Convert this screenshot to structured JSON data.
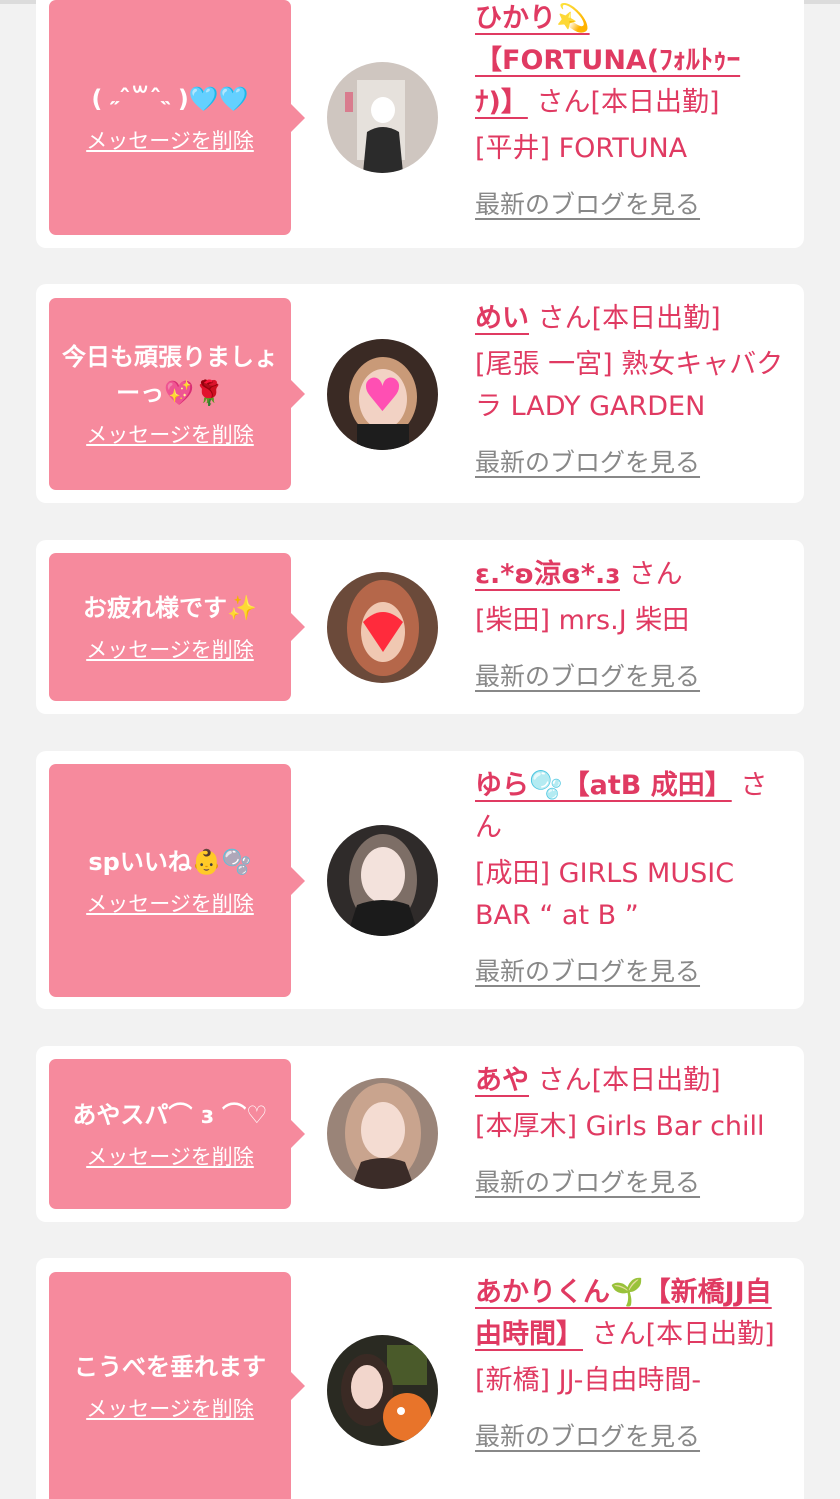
{
  "delete_label": "メッセージを削除",
  "blog_label": "最新のブログを見る",
  "san_label": "さん",
  "cards": [
    {
      "message": "( ˶ˆ꒳ˆ˵ )🩵🩵",
      "name": "ひかり💫【FORTUNA(ﾌｫﾙﾄｩｰﾅ)】",
      "status": "[本日出勤]",
      "shop": "[平井] FORTUNA"
    },
    {
      "message": "今日も頑張りましょーっ💖🌹",
      "name": "めい",
      "status": "[本日出勤]",
      "shop": "[尾張 一宮] 熟女キャバクラ LADY GARDEN"
    },
    {
      "message": "お疲れ様です✨",
      "name": "ɛ.*ʚ涼ɞ*.ɜ",
      "status": "",
      "shop": "[柴田] mrs.J 柴田"
    },
    {
      "message": "spいいね👶🫧",
      "name": "ゆら🫧【atB 成田】",
      "status": "",
      "shop": "[成田] GIRLS MUSIC BAR “ at B ”"
    },
    {
      "message": "あやスパ⌒ ɜ ⌒♡",
      "name": "あや",
      "status": "[本日出勤]",
      "shop": "[本厚木] Girls Bar chill"
    },
    {
      "message": "こうべを垂れます",
      "name": "あかりくん🌱【新橋JJ自由時間】",
      "status": "[本日出勤]",
      "shop": "[新橋] JJ-自由時間-"
    }
  ],
  "colors": {
    "background": "#f2f2f2",
    "bubble": "#f68a9d",
    "accent": "#e03a62",
    "link_gray": "#888888"
  }
}
